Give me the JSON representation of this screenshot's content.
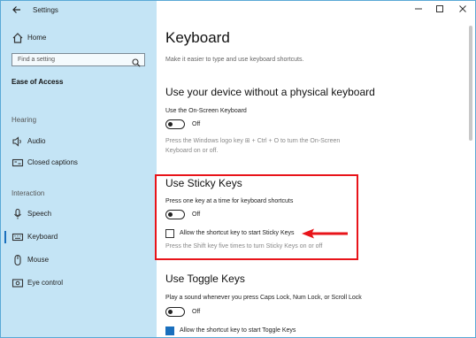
{
  "window": {
    "title": "Settings"
  },
  "sidebar": {
    "home_label": "Home",
    "search_placeholder": "Find a setting",
    "category": "Ease of Access",
    "hearing_header": "Hearing",
    "audio_label": "Audio",
    "captions_label": "Closed captions",
    "interaction_header": "Interaction",
    "speech_label": "Speech",
    "keyboard_label": "Keyboard",
    "mouse_label": "Mouse",
    "eye_label": "Eye control"
  },
  "main": {
    "title": "Keyboard",
    "subtitle": "Make it easier to type and use keyboard shortcuts.",
    "osk": {
      "heading": "Use your device without a physical keyboard",
      "label": "Use the On-Screen Keyboard",
      "state": "Off",
      "hint_line1": "Press the Windows logo key ⊞ + Ctrl + O to turn the On-Screen",
      "hint_line2": "Keyboard on or off."
    },
    "sticky": {
      "heading": "Use Sticky Keys",
      "label": "Press one key at a time for keyboard shortcuts",
      "state": "Off",
      "shortcut_label": "Allow the shortcut key to start Sticky Keys",
      "hint": "Press the Shift key five times to turn Sticky Keys on or off"
    },
    "toggle": {
      "heading": "Use Toggle Keys",
      "label": "Play a sound whenever you press Caps Lock, Num Lock, or Scroll Lock",
      "state": "Off",
      "shortcut_label": "Allow the shortcut key to start Toggle Keys"
    }
  },
  "colors": {
    "accent": "#1a6fbd",
    "highlight": "#e8141a",
    "sidebar_bg": "#c4e4f5"
  }
}
